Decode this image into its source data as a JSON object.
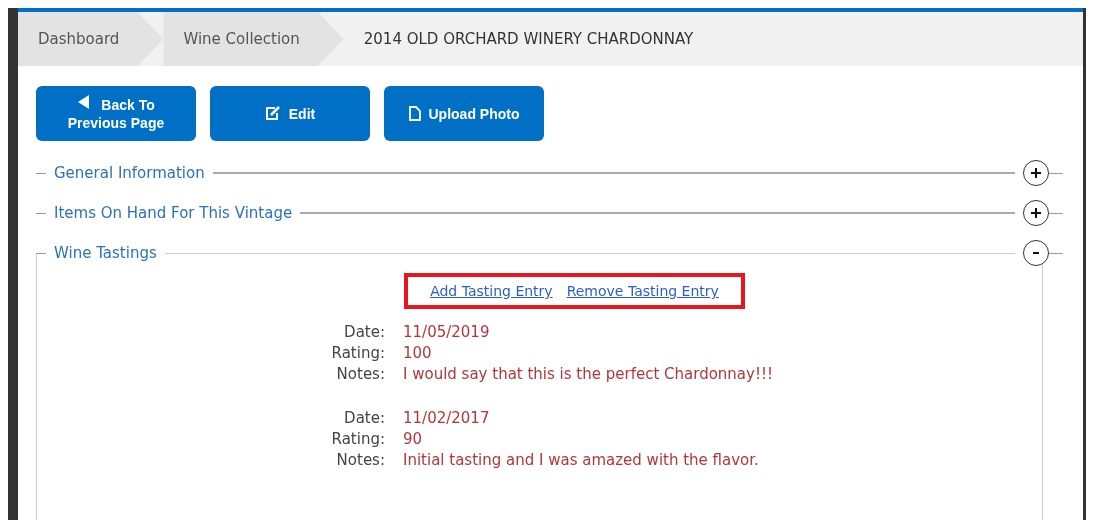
{
  "breadcrumb": [
    {
      "label": "Dashboard",
      "selected": false
    },
    {
      "label": "Wine Collection",
      "selected": false
    },
    {
      "label": "2014 OLD ORCHARD WINERY CHARDONNAY",
      "selected": true
    }
  ],
  "buttons": [
    {
      "kind": "back",
      "label_lines": [
        "Back To",
        "Previous Page"
      ]
    },
    {
      "kind": "edit",
      "label_lines": [
        "Edit"
      ]
    },
    {
      "kind": "upload",
      "label_lines": [
        "Upload Photo"
      ]
    }
  ],
  "sections": [
    {
      "title": "General Information",
      "expanded": false
    },
    {
      "title": "Items On Hand For This Vintage",
      "expanded": false
    },
    {
      "title": "Wine Tastings",
      "expanded": true,
      "links": {
        "highlighted": true,
        "items": [
          "Add Tasting Entry",
          "Remove Tasting Entry"
        ]
      },
      "entries": [
        {
          "fields": [
            {
              "label": "Date:",
              "value": "11/05/2019"
            },
            {
              "label": "Rating:",
              "value": "100"
            },
            {
              "label": "Notes:",
              "value": "I would say that this is the perfect Chardonnay!!!"
            }
          ]
        },
        {
          "fields": [
            {
              "label": "Date:",
              "value": "11/02/2017"
            },
            {
              "label": "Rating:",
              "value": "90"
            },
            {
              "label": "Notes:",
              "value": "Initial tasting and I was amazed with the flavor."
            }
          ]
        }
      ]
    }
  ]
}
